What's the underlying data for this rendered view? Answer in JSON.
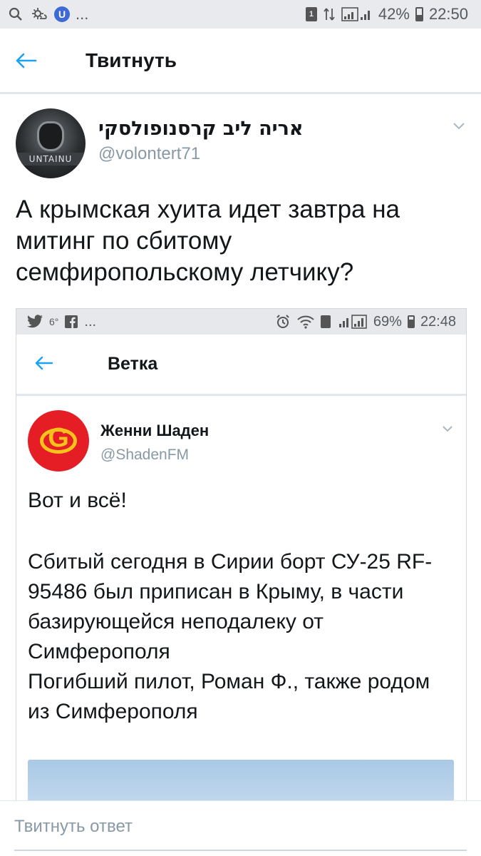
{
  "status_bar": {
    "battery": "42%",
    "battery_level": 0.42,
    "time": "22:50",
    "more": "..."
  },
  "header": {
    "title": "Твитнуть"
  },
  "tweet": {
    "author_name": "אריה ליב קרסנופולסקי",
    "handle": "@volontert71",
    "avatar_text": "UNTAINU",
    "text": "А крымская хуита идет завтра на митинг по сбитому семфиропольскому летчику?"
  },
  "embedded_screenshot": {
    "status_bar": {
      "notification_count": "6°",
      "more": "...",
      "battery": "69%",
      "battery_level": 0.69,
      "time": "22:48"
    },
    "header": {
      "title": "Ветка"
    },
    "tweet": {
      "author_name": "Женни Шаден",
      "handle": "@ShadenFM",
      "line_1": "Вот и всё!",
      "line_2": "Сбитый сегодня в Сирии борт СУ-25 RF-95486 был приписан в Крыму, в части базирующейся неподалеку от Симферополя",
      "line_3": "Погибший пилот, Роман Ф., также родом из Симферополя"
    }
  },
  "reply": {
    "placeholder": "Твитнуть ответ"
  },
  "colors": {
    "accent": "#1da1f2",
    "muted": "#8899a6",
    "text": "#14171a",
    "divider": "#e1e8ed"
  }
}
